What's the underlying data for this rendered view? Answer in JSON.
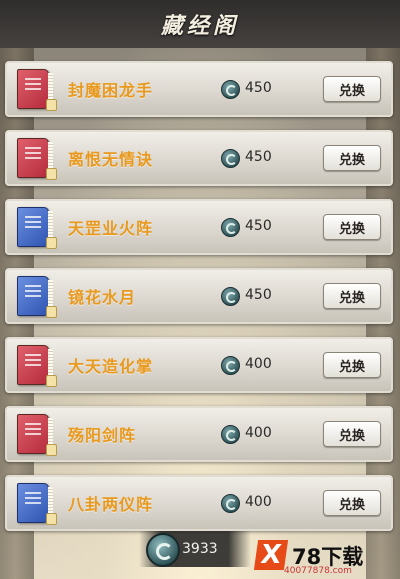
{
  "header": {
    "title": "藏经阁"
  },
  "currency": {
    "icon": "jade-coin-icon",
    "balance": "3933"
  },
  "items": [
    {
      "name": "封魔困龙手",
      "book_color": "red",
      "price": "450",
      "button": "兑换"
    },
    {
      "name": "离恨无情诀",
      "book_color": "red",
      "price": "450",
      "button": "兑换"
    },
    {
      "name": "天罡业火阵",
      "book_color": "blue",
      "price": "450",
      "button": "兑换"
    },
    {
      "name": "镜花水月",
      "book_color": "blue",
      "price": "450",
      "button": "兑换"
    },
    {
      "name": "大天造化掌",
      "book_color": "red",
      "price": "400",
      "button": "兑换"
    },
    {
      "name": "殇阳剑阵",
      "book_color": "red",
      "price": "400",
      "button": "兑换"
    },
    {
      "name": "八卦两仪阵",
      "book_color": "blue",
      "price": "400",
      "button": "兑换"
    }
  ],
  "watermark": {
    "mark": "X",
    "brand": "78下载",
    "url": "40077878.com"
  },
  "colors": {
    "item_name": "#e99a1e",
    "book_red": "#c8394a",
    "book_blue": "#3c62c2"
  }
}
